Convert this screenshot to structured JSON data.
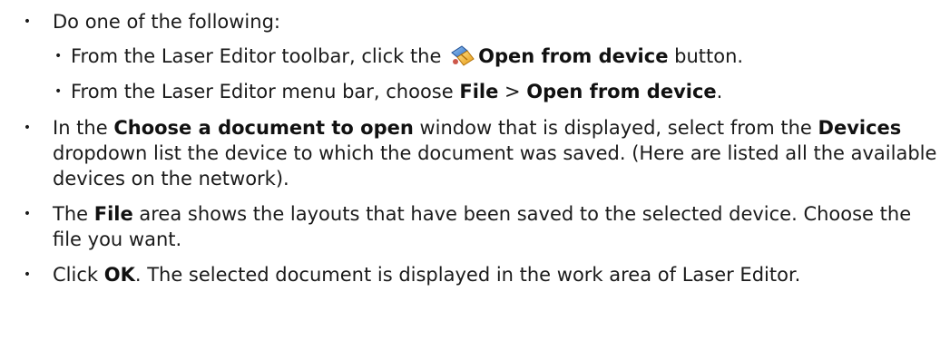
{
  "bullet_char": "•",
  "steps": {
    "s1": {
      "text": "Do one of the following:"
    },
    "s1a": {
      "pre": "From the Laser Editor toolbar, click the ",
      "bold": "Open from device",
      "post": " button.",
      "icon": "open-from-device-icon"
    },
    "s1b": {
      "pre": "From the Laser Editor menu bar, choose ",
      "bold1": "File",
      "mid": " > ",
      "bold2": "Open from device",
      "post": "."
    },
    "s2": {
      "pre": "In the ",
      "bold1": "Choose a document to open",
      "mid": " window that is displayed, select from the ",
      "bold2": "Devices",
      "post": " dropdown list the device to which the document was saved. (Here are listed all the available devices on the network)."
    },
    "s3": {
      "pre": "The ",
      "bold": "File",
      "post": " area shows the layouts that have been saved to the selected device. Choose the file you want."
    },
    "s4": {
      "pre": "Click ",
      "bold": "OK",
      "post": ". The selected document is displayed in the work area of Laser Editor."
    }
  },
  "colors": {
    "text": "#1a1a1a",
    "icon_blue": "#3a7bd5",
    "icon_yellow": "#f2b632"
  }
}
